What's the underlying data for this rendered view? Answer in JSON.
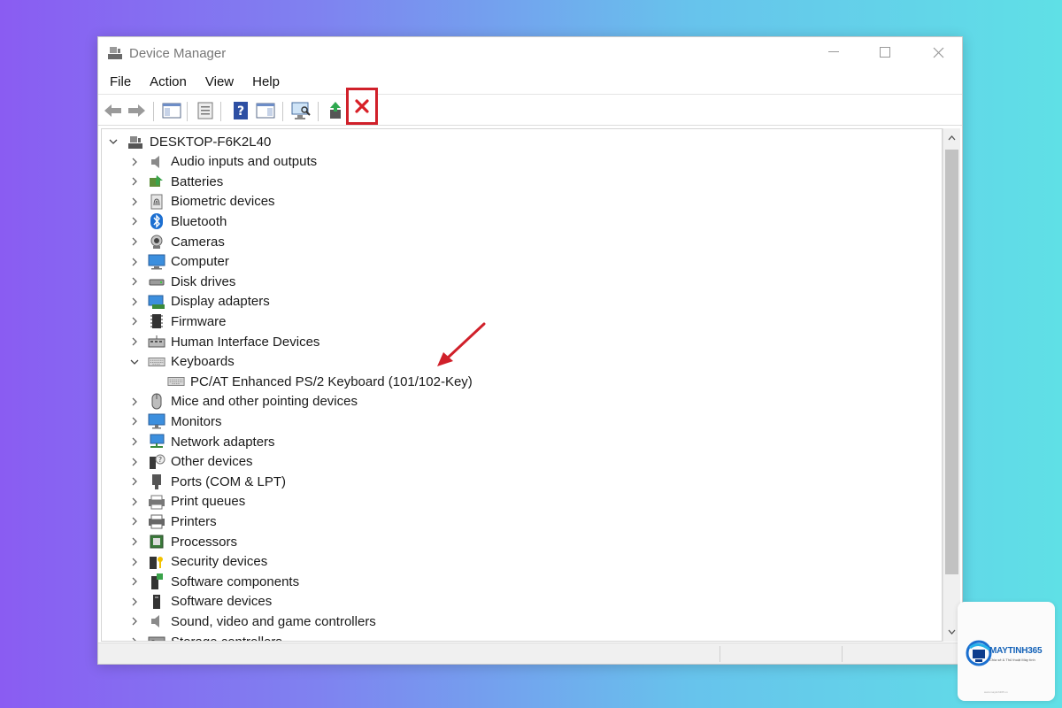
{
  "window": {
    "title": "Device Manager",
    "controls": [
      "minimize",
      "maximize",
      "close"
    ]
  },
  "menu": [
    "File",
    "Action",
    "View",
    "Help"
  ],
  "toolbar": {
    "icons": [
      "back-arrow-icon",
      "forward-arrow-icon",
      "show-hide-console-tree-icon",
      "properties-icon",
      "help-icon",
      "show-action-pane-icon",
      "scan-hardware-icon",
      "update-driver-icon",
      "uninstall-device-icon"
    ],
    "highlighted": "uninstall-device-icon",
    "highlight_color": "#d0202a"
  },
  "tree": {
    "root": "DESKTOP-F6K2L40",
    "categories": [
      {
        "label": "Audio inputs and outputs",
        "icon": "speaker-icon"
      },
      {
        "label": "Batteries",
        "icon": "battery-icon"
      },
      {
        "label": "Biometric devices",
        "icon": "fingerprint-icon"
      },
      {
        "label": "Bluetooth",
        "icon": "bluetooth-icon"
      },
      {
        "label": "Cameras",
        "icon": "camera-icon"
      },
      {
        "label": "Computer",
        "icon": "computer-icon"
      },
      {
        "label": "Disk drives",
        "icon": "disk-drive-icon"
      },
      {
        "label": "Display adapters",
        "icon": "display-adapter-icon"
      },
      {
        "label": "Firmware",
        "icon": "firmware-icon"
      },
      {
        "label": "Human Interface Devices",
        "icon": "hid-icon"
      },
      {
        "label": "Keyboards",
        "icon": "keyboard-icon",
        "expanded": true
      },
      {
        "label": "PC/AT Enhanced PS/2 Keyboard (101/102-Key)",
        "icon": "keyboard-icon",
        "child": true
      },
      {
        "label": "Mice and other pointing devices",
        "icon": "mouse-icon"
      },
      {
        "label": "Monitors",
        "icon": "monitor-icon"
      },
      {
        "label": "Network adapters",
        "icon": "network-icon"
      },
      {
        "label": "Other devices",
        "icon": "unknown-device-icon"
      },
      {
        "label": "Ports (COM & LPT)",
        "icon": "port-icon"
      },
      {
        "label": "Print queues",
        "icon": "print-queue-icon"
      },
      {
        "label": "Printers",
        "icon": "printer-icon"
      },
      {
        "label": "Processors",
        "icon": "processor-icon"
      },
      {
        "label": "Security devices",
        "icon": "security-device-icon"
      },
      {
        "label": "Software components",
        "icon": "software-component-icon"
      },
      {
        "label": "Software devices",
        "icon": "software-device-icon"
      },
      {
        "label": "Sound, video and game controllers",
        "icon": "sound-controller-icon"
      },
      {
        "label": "Storage controllers",
        "icon": "storage-controller-icon"
      }
    ],
    "annotation_arrow_color": "#d0202a"
  },
  "watermark": {
    "name": "MAYTINH365",
    "tagline": "Chia sẻ & Thủ thuật Máy tính",
    "footer": "www.maytinh365.vn"
  }
}
